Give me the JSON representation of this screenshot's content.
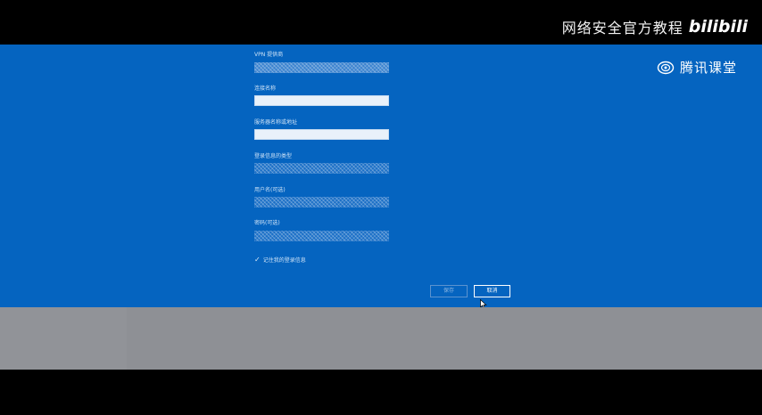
{
  "watermark": {
    "text": "网络安全官方教程",
    "logo": "bilibili"
  },
  "brand": {
    "icon": "tencent-classroom-logo-icon",
    "name": "腾讯课堂"
  },
  "form": {
    "vpn_provider_label": "VPN 提供商",
    "connection_name_label": "连接名称",
    "connection_name_value": "",
    "server_label": "服务器名称或地址",
    "server_value": "",
    "signin_type_label": "登录信息的类型",
    "username_label": "用户名(可选)",
    "password_label": "密码(可选)",
    "remember_label": "记住我的登录信息",
    "remember_checked": true
  },
  "buttons": {
    "save": "保存",
    "cancel": "取消"
  },
  "colors": {
    "dialog_bg": "#0564c0",
    "gray_area": "#8e9095"
  }
}
